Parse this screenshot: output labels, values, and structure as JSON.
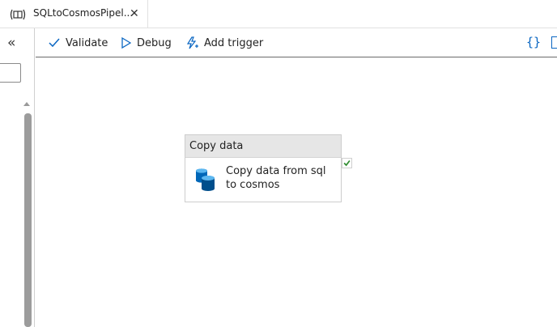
{
  "tab": {
    "title": "SQLtoCosmosPipel...",
    "close": "✕"
  },
  "left_panel": {
    "collapse_glyph": "«"
  },
  "toolbar": {
    "validate_label": "Validate",
    "debug_label": "Debug",
    "add_trigger_label": "Add trigger",
    "code_glyph": "{}"
  },
  "canvas": {
    "activity": {
      "type_label": "Copy data",
      "name": "Copy data from sql to cosmos",
      "status": "succeeded"
    }
  },
  "colors": {
    "accent": "#0a66c2",
    "success": "#2f8c2f",
    "cosmos_blue": "#0067b8"
  }
}
